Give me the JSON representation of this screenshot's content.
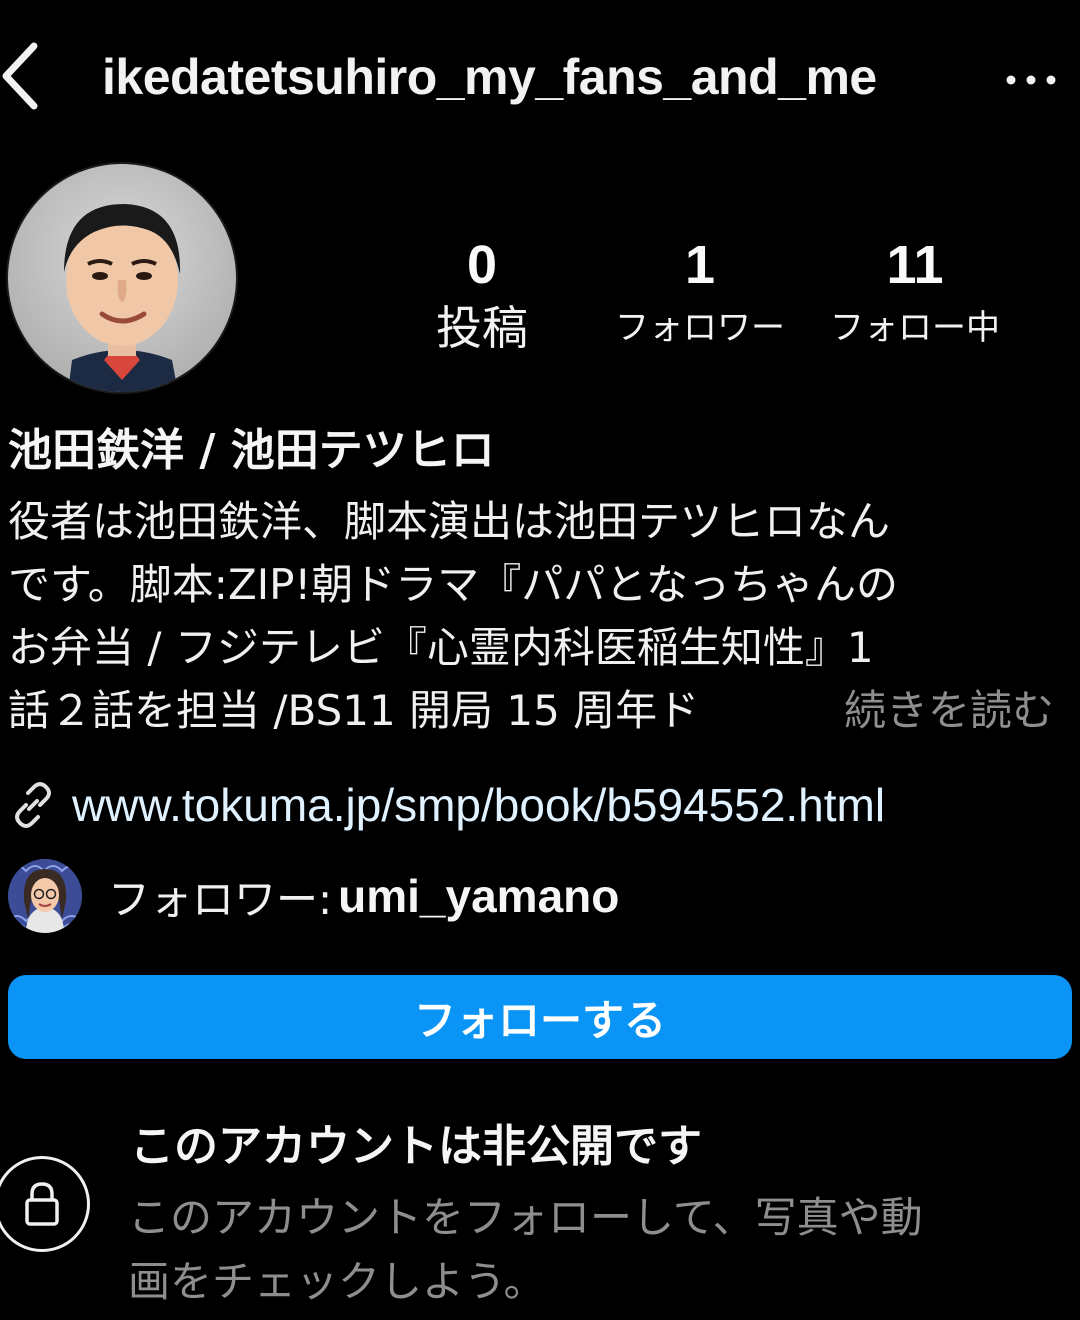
{
  "header": {
    "username": "ikedatetsuhiro_my_fans_and_me",
    "back_icon": "chevron-left-icon",
    "more_icon": "more-horizontal-icon"
  },
  "stats": {
    "posts_count": "0",
    "posts_label": "投稿",
    "followers_count": "1",
    "followers_label": "フォロワー",
    "following_count": "11",
    "following_label": "フォロー中"
  },
  "profile": {
    "display_name": "池田鉄洋 / 池田テツヒロ",
    "bio_lines": [
      "役者は池田鉄洋、脚本演出は池田テツヒロなん",
      "です。脚本:ZIP!朝ドラマ『パパとなっちゃんの",
      "お弁当 / フジテレビ『心霊内科医稲生知性』1",
      "話２話を担当 /BS11 開局 15 周年ド"
    ],
    "read_more": "続きを読む",
    "link_icon": "link-icon",
    "link": "www.tokuma.jp/smp/book/b594552.html"
  },
  "mutual": {
    "label": "フォロワー: ",
    "username": "umi_yamano"
  },
  "follow_button_label": "フォローする",
  "private_notice": {
    "icon": "lock-icon",
    "title": "このアカウントは非公開です",
    "desc_lines": [
      "このアカウントをフォローして、写真や動",
      "画をチェックしよう。"
    ]
  },
  "colors": {
    "background": "#000000",
    "button": "#0a95f6",
    "muted_text": "#8e8e8e",
    "link_text": "#e0f1ff"
  }
}
